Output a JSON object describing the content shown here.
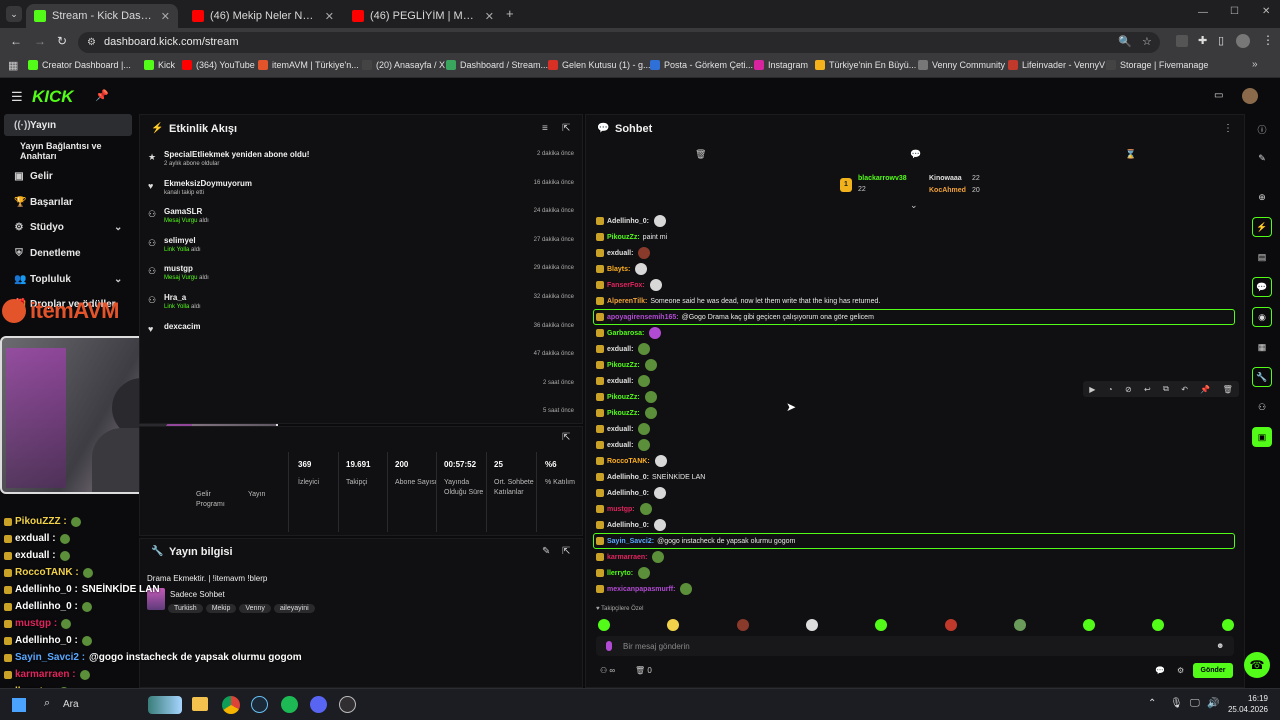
{
  "browser": {
    "tabs": [
      {
        "label": "Stream - Kick Dashboard",
        "color": "#53fc18"
      },
      {
        "label": "(46) Mekip Neler Neler 66.Bölüm",
        "color": "#ff0000"
      },
      {
        "label": "(46) PEGLİYİM | Madara Olduk",
        "color": "#ff0000"
      }
    ],
    "new_tab": "+",
    "url": "dashboard.kick.com/stream",
    "bookmarks": [
      {
        "label": "Creator Dashboard |...",
        "color": "#53fc18"
      },
      {
        "label": "Kick",
        "color": "#53fc18"
      },
      {
        "label": "(364) YouTube",
        "color": "#ff0000"
      },
      {
        "label": "itemAVM | Türkiye'n...",
        "color": "#e3542b"
      },
      {
        "label": "(20) Anasayfa / X",
        "color": "#444"
      },
      {
        "label": "Dashboard / Stream...",
        "color": "#3aa55d"
      },
      {
        "label": "Gelen Kutusu (1) - g...",
        "color": "#d93025"
      },
      {
        "label": "Posta - Görkem Çeti...",
        "color": "#2f6fd8"
      },
      {
        "label": "Instagram",
        "color": "#d6249f"
      },
      {
        "label": "Türkiye'nin En Büyü...",
        "color": "#f5b21b"
      },
      {
        "label": "Venny Community",
        "color": "#777"
      },
      {
        "label": "Lifeinvader - VennyV",
        "color": "#c0392b"
      },
      {
        "label": "Storage | Fivemanage",
        "color": "#444"
      }
    ]
  },
  "kick": {
    "logo": "KICK",
    "sidebar": [
      {
        "label": "Yayın",
        "icon": "broadcast-icon"
      },
      {
        "label": "Yayın Bağlantısı ve Anahtarı",
        "icon": ""
      },
      {
        "label": "Gelir",
        "icon": "money-icon"
      },
      {
        "label": "Başarılar",
        "icon": "trophy-icon"
      },
      {
        "label": "Stüdyo",
        "icon": "gear-icon"
      },
      {
        "label": "Denetleme",
        "icon": "shield-icon"
      },
      {
        "label": "Topluluk",
        "icon": "users-icon"
      },
      {
        "label": "Droplar ve ödüller",
        "icon": "gift-icon"
      }
    ],
    "itemavm_logo": "itemAVM"
  },
  "activity": {
    "title": "Etkinlik Akışı",
    "items": [
      {
        "name": "SpecialEtliekmek yeniden abone oldu!",
        "sub": "2 aylık abone oldular",
        "time": "2 dakika önce",
        "green": false
      },
      {
        "name": "EkmeksizDoymuyorum",
        "sub": "kanalı takip etti",
        "time": "16 dakika önce",
        "green": false
      },
      {
        "name": "GamaSLR",
        "sub": "Mesaj Vurgu",
        "sub2": " aldı",
        "time": "24 dakika önce",
        "green": true
      },
      {
        "name": "selimyel",
        "sub": "Link Yolla",
        "sub2": " aldı",
        "time": "27 dakika önce",
        "green": true
      },
      {
        "name": "mustgp",
        "sub": "Mesaj Vurgu",
        "sub2": " aldı",
        "time": "29 dakika önce",
        "green": true
      },
      {
        "name": "Hra_a",
        "sub": "Link Yolla",
        "sub2": " aldı",
        "time": "32 dakika önce",
        "green": true
      },
      {
        "name": "dexcacim",
        "sub": "",
        "time": "36 dakika önce",
        "green": false
      },
      {
        "name": "",
        "sub": "",
        "time": "47 dakika önce",
        "green": false
      },
      {
        "name": "",
        "sub": "",
        "time": "2 saat önce",
        "green": false
      },
      {
        "name": "",
        "sub": "",
        "time": "5 saat önce",
        "green": false
      }
    ]
  },
  "stats": [
    {
      "value": "",
      "label": "Gelir Programı"
    },
    {
      "value": "",
      "label": "Yayın"
    },
    {
      "value": "369",
      "label": "İzleyici"
    },
    {
      "value": "19.691",
      "label": "Takipçi"
    },
    {
      "value": "200",
      "label": "Abone Sayısı"
    },
    {
      "value": "00:57:52",
      "label": "Yayında Olduğu Süre"
    },
    {
      "value": "25",
      "label": "Ort. Sohbete Katılanlar"
    },
    {
      "value": "%6",
      "label": "% Katılım"
    }
  ],
  "stream_info": {
    "title": "Yayın bilgisi",
    "stream_title": "Drama Ekmektir. | !itemavm !blerp",
    "category": "Sadece Sohbet",
    "tags": [
      "Turkish",
      "Mekip",
      "Venny",
      "aileyayini"
    ]
  },
  "chat": {
    "title": "Sohbet",
    "leaderboard": [
      {
        "name": "blackarrowv38",
        "count": "22"
      },
      {
        "name": "Kinowaaa",
        "count": "22"
      },
      {
        "name": "KocAhmed",
        "count": "20"
      }
    ],
    "messages": [
      {
        "user": "Adellinho_0:",
        "text": "",
        "color": "#e0e0e0",
        "emote": "w",
        "hl": false
      },
      {
        "user": "PikouzZz:",
        "text": "paint mi",
        "color": "#53fc18",
        "emote": "",
        "hl": false
      },
      {
        "user": "exduall:",
        "text": "",
        "color": "#e0e0e0",
        "emote": "r",
        "hl": false
      },
      {
        "user": "Blayts:",
        "text": "",
        "color": "#ffb020",
        "emote": "w",
        "hl": false
      },
      {
        "user": "FanserFox:",
        "text": "",
        "color": "#e0245e",
        "emote": "w",
        "hl": false
      },
      {
        "user": "AlperenTilk:",
        "text": "Someone said he was dead, now let them write that the king has returned.",
        "color": "#f2a33a",
        "emote": "",
        "hl": false
      },
      {
        "user": "apoyagirensemih165:",
        "text": "@Gogo Drama kaç gibi geçicen çalışıyorum ona göre gelicem",
        "color": "#b24bd3",
        "emote": "",
        "hl": true
      },
      {
        "user": "Garbarosa:",
        "text": "",
        "color": "#53fc18",
        "emote": "p",
        "hl": false
      },
      {
        "user": "exduall:",
        "text": "",
        "color": "#e0e0e0",
        "emote": "g",
        "hl": false
      },
      {
        "user": "PikouzZz:",
        "text": "",
        "color": "#53fc18",
        "emote": "g",
        "hl": false
      },
      {
        "user": "exduall:",
        "text": "",
        "color": "#e0e0e0",
        "emote": "g",
        "hl": false
      },
      {
        "user": "PikouzZz:",
        "text": "",
        "color": "#53fc18",
        "emote": "g",
        "hl": false
      },
      {
        "user": "PikouzZz:",
        "text": "",
        "color": "#53fc18",
        "emote": "g",
        "hl": false
      },
      {
        "user": "exduall:",
        "text": "",
        "color": "#e0e0e0",
        "emote": "g",
        "hl": false
      },
      {
        "user": "exduall:",
        "text": "",
        "color": "#e0e0e0",
        "emote": "g",
        "hl": false
      },
      {
        "user": "RoccoTANK:",
        "text": "",
        "color": "#ffb020",
        "emote": "w",
        "hl": false
      },
      {
        "user": "Adellinho_0:",
        "text": "SNEİNKİDE LAN",
        "color": "#e0e0e0",
        "emote": "",
        "hl": false
      },
      {
        "user": "Adellinho_0:",
        "text": "",
        "color": "#e0e0e0",
        "emote": "w",
        "hl": false
      },
      {
        "user": "mustgp:",
        "text": "",
        "color": "#e0245e",
        "emote": "g",
        "hl": false
      },
      {
        "user": "Adellinho_0:",
        "text": "",
        "color": "#e0e0e0",
        "emote": "w",
        "hl": false
      },
      {
        "user": "Sayin_Savci2:",
        "text": "@gogo instacheck de yapsak olurmu gogom",
        "color": "#5aa8ff",
        "emote": "",
        "hl": true
      },
      {
        "user": "karmarraen:",
        "text": "",
        "color": "#e0245e",
        "emote": "g",
        "hl": false
      },
      {
        "user": "llerryto:",
        "text": "",
        "color": "#53fc18",
        "emote": "g",
        "hl": false
      },
      {
        "user": "mexicanpapasmurff:",
        "text": "",
        "color": "#b24bd3",
        "emote": "g",
        "hl": false
      }
    ],
    "followers_only": "Takipçilere Özel",
    "input_placeholder": "Bir mesaj gönderin",
    "send": "Gönder",
    "points": "∞",
    "count": "0"
  },
  "overlay_chat": [
    {
      "user": "PikouZZZ :",
      "text": "",
      "color": "#f2d24a"
    },
    {
      "user": "exduall :",
      "text": "",
      "color": "#ffffff"
    },
    {
      "user": "exduall :",
      "text": "",
      "color": "#ffffff"
    },
    {
      "user": "RoccoTANK :",
      "text": "",
      "color": "#f2d24a"
    },
    {
      "user": "Adellinho_0 :",
      "text": "SNEİNKİDE LAN",
      "color": "#ffffff"
    },
    {
      "user": "Adellinho_0 :",
      "text": "",
      "color": "#ffffff"
    },
    {
      "user": "mustgp :",
      "text": "",
      "color": "#e0245e"
    },
    {
      "user": "Adellinho_0 :",
      "text": "",
      "color": "#ffffff"
    },
    {
      "user": "Sayin_Savci2 :",
      "text": "@gogo instacheck de yapsak olurmu gogom",
      "color": "#5aa8ff"
    },
    {
      "user": "karmarraen :",
      "text": "",
      "color": "#e0245e"
    },
    {
      "user": "llerryto :",
      "text": "",
      "color": "#f2d24a"
    },
    {
      "user": "mexicanpapasmurff :",
      "text": "",
      "color": "#b24bd3"
    }
  ],
  "taskbar": {
    "search": "Ara",
    "time": "16:19",
    "date": "25.04.2026"
  }
}
